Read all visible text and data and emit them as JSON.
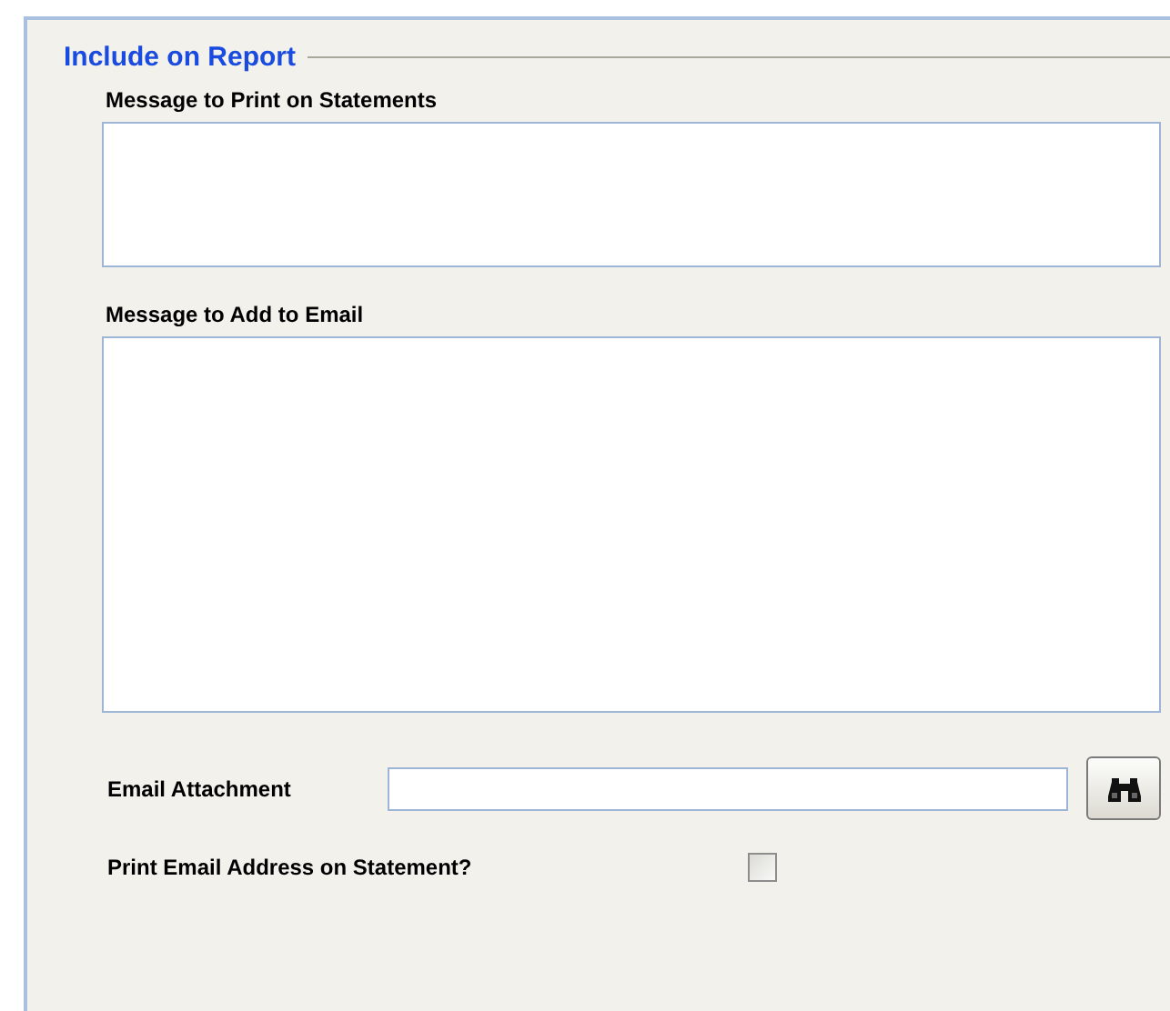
{
  "group": {
    "title": "Include on Report"
  },
  "statement_message": {
    "label": "Message to Print on Statements"
  },
  "email_message": {
    "label": "Message to Add to Email"
  },
  "email_attachment": {
    "label": "Email Attachment"
  },
  "print_email_address": {
    "label": "Print Email Address on Statement?",
    "checked": false
  }
}
